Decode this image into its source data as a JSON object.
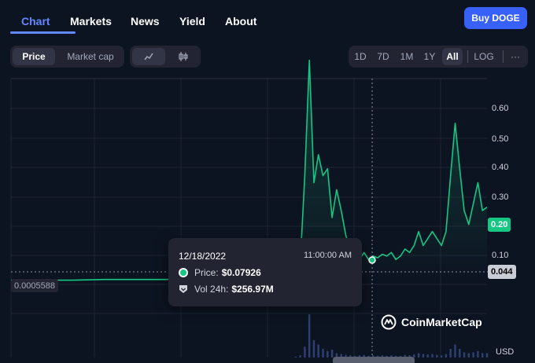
{
  "nav": {
    "tabs": [
      {
        "label": "Chart",
        "active": true
      },
      {
        "label": "Markets",
        "active": false
      },
      {
        "label": "News",
        "active": false
      },
      {
        "label": "Yield",
        "active": false
      },
      {
        "label": "About",
        "active": false
      }
    ],
    "buy_label": "Buy DOGE"
  },
  "controls": {
    "metric": [
      "Price",
      "Market cap"
    ],
    "metric_selected": "Price",
    "chart_style_icons": [
      "line-chart-icon",
      "candlestick-icon"
    ],
    "ranges": [
      "1D",
      "7D",
      "1M",
      "1Y",
      "All"
    ],
    "range_selected": "All",
    "log_label": "LOG",
    "more_label": "···"
  },
  "tooltip": {
    "date": "12/18/2022",
    "time": "11:00:00 AM",
    "price_label": "Price:",
    "price_value": "$0.07926",
    "volume_label": "Vol 24h:",
    "volume_value": "$256.97M"
  },
  "axis": {
    "y_ticks": [
      "0.60",
      "0.50",
      "0.40",
      "0.30",
      "0.10"
    ],
    "current_price_badge": "0.20",
    "crosshair_badge": "0.044",
    "left_badge": "0.0005588",
    "currency": "USD"
  },
  "watermark": "CoinMarketCap",
  "colors": {
    "accent": "#6188ff",
    "buy": "#3861fb",
    "line": "#16c784",
    "background": "#0d1421"
  },
  "chart_data": {
    "type": "area",
    "series": [
      {
        "values": [
          0.0006,
          0.0006,
          0.001,
          0.003,
          0.003,
          0.003,
          0.003,
          0.004,
          0.0045,
          0.007,
          0.03,
          0.05,
          0.3,
          0.63,
          0.28,
          0.36,
          0.3,
          0.32,
          0.18,
          0.26,
          0.2,
          0.13,
          0.08,
          0.06,
          0.06,
          0.08,
          0.06,
          0.07,
          0.065,
          0.075,
          0.07,
          0.08,
          0.06,
          0.07,
          0.09,
          0.08,
          0.1,
          0.14,
          0.1,
          0.12,
          0.14,
          0.12,
          0.1,
          0.14,
          0.3,
          0.45,
          0.32,
          0.2,
          0.16,
          0.22,
          0.28,
          0.2,
          0.21
        ]
      }
    ],
    "ylim": [
      0,
      0.65
    ],
    "crosshair_value": 0.044,
    "current_value": 0.2,
    "volume_relative": [
      0,
      0,
      0,
      0,
      0,
      0,
      0,
      0,
      0,
      0,
      0.02,
      0.05,
      0.25,
      1.0,
      0.4,
      0.3,
      0.2,
      0.15,
      0.18,
      0.1,
      0.08,
      0.06,
      0.05,
      0.04,
      0.05,
      0.06,
      0.04,
      0.05,
      0.04,
      0.05,
      0.04,
      0.05,
      0.04,
      0.04,
      0.06,
      0.05,
      0.07,
      0.1,
      0.08,
      0.07,
      0.08,
      0.06,
      0.05,
      0.08,
      0.2,
      0.3,
      0.2,
      0.12,
      0.1,
      0.12,
      0.15,
      0.1,
      0.1
    ]
  }
}
